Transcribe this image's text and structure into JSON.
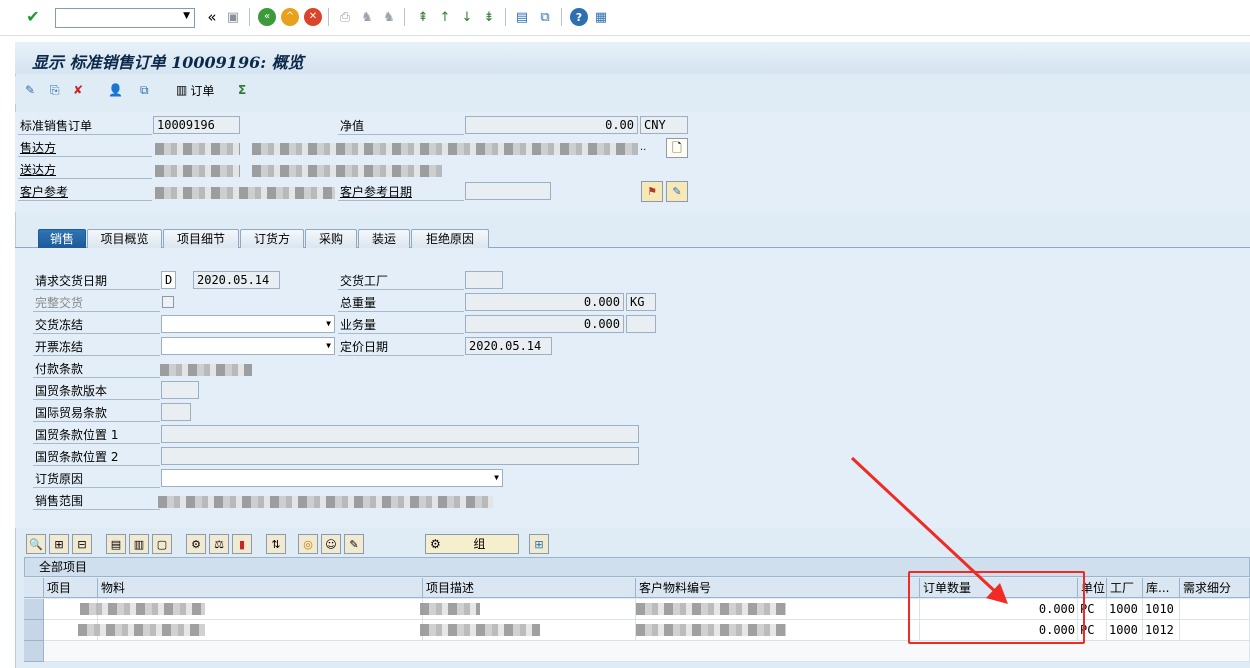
{
  "window_title": "显示 标准销售订单 10009196: 概览",
  "system_toolbar": {
    "command_field_value": "",
    "icons": [
      "enter-icon",
      "save-icon",
      "back-icon",
      "exit-icon",
      "cancel-icon",
      "print-icon",
      "find-icon",
      "find-next-icon",
      "first-page-icon",
      "prev-page-icon",
      "next-page-icon",
      "last-page-icon",
      "new-session-icon",
      "shortcut-icon",
      "help-icon",
      "customize-layout-icon"
    ]
  },
  "app_toolbar": {
    "order_button_label": "订单"
  },
  "header": {
    "order_label": "标准销售订单",
    "order_number": "10009196",
    "net_value_label": "净值",
    "net_value": "0.00",
    "currency": "CNY",
    "sold_to_label": "售达方",
    "ship_to_label": "送达方",
    "sold_to_ellipsis": "..",
    "cust_ref_label": "客户参考",
    "cust_ref_date_label": "客户参考日期",
    "cust_ref_date": ""
  },
  "tabs": [
    "销售",
    "项目概览",
    "项目细节",
    "订货方",
    "采购",
    "装运",
    "拒绝原因"
  ],
  "sales_tab": {
    "req_delivery_date_label": "请求交货日期",
    "req_delivery_date_type": "D",
    "req_delivery_date": "2020.05.14",
    "delivering_plant_label": "交货工厂",
    "complete_delivery_label": "完整交货",
    "total_weight_label": "总重量",
    "total_weight": "0.000",
    "weight_unit": "KG",
    "delivery_block_label": "交货冻结",
    "volume_label": "业务量",
    "volume": "0.000",
    "billing_block_label": "开票冻结",
    "pricing_date_label": "定价日期",
    "pricing_date": "2020.05.14",
    "payment_terms_label": "付款条款",
    "incoterms_version_label": "国贸条款版本",
    "incoterms_label": "国际贸易条款",
    "incoterms_loc1_label": "国贸条款位置 1",
    "incoterms_loc2_label": "国贸条款位置 2",
    "order_reason_label": "订货原因",
    "sales_area_label": "销售范围"
  },
  "items_grid": {
    "title": "全部项目",
    "group_button_label": "组",
    "columns": [
      "项目",
      "物料",
      "项目描述",
      "客户物料编号",
      "订单数量",
      "单位",
      "工厂",
      "库...",
      "需求细分"
    ],
    "rows": [
      {
        "qty": "0.000",
        "unit": "PC",
        "plant": "1000",
        "sloc": "1010"
      },
      {
        "qty": "0.000",
        "unit": "PC",
        "plant": "1000",
        "sloc": "1012"
      }
    ]
  },
  "colors": {
    "annotation": "#f02a24",
    "active_tab": "#1c5a98",
    "window_bg": "#dfebf5"
  }
}
